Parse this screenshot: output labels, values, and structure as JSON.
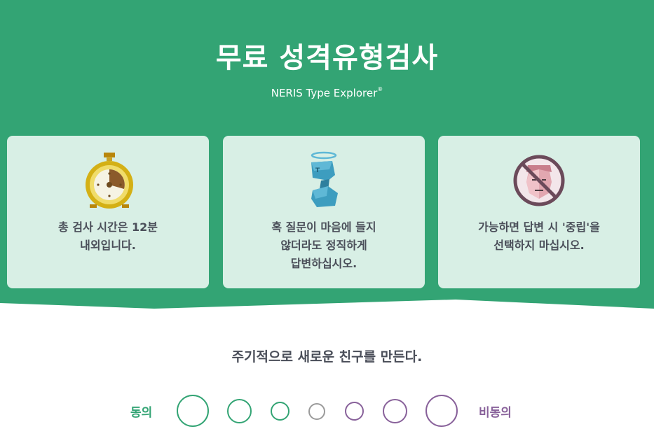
{
  "header": {
    "title": "무료 성격유형검사",
    "subtitle": "NERIS Type Explorer",
    "subtitle_mark": "®"
  },
  "cards": [
    {
      "icon": "stopwatch-icon",
      "text_lines": [
        "총 검사 시간은 12분",
        "내외입니다."
      ]
    },
    {
      "icon": "halo-character-icon",
      "text_lines": [
        "혹 질문이 마음에 들지",
        "않더라도 정직하게",
        "답변하십시오."
      ]
    },
    {
      "icon": "no-neutral-face-icon",
      "text_lines": [
        "가능하면 답변 시 '중립'을",
        "선택하지 마십시오."
      ]
    }
  ],
  "question": {
    "text": "주기적으로 새로운 친구를 만든다.",
    "agree_label": "동의",
    "disagree_label": "비동의",
    "options_count": 7
  },
  "colors": {
    "brand_green": "#33a474",
    "card_bg": "#d8efe5",
    "neutral_gray": "#9a9a9a",
    "disagree_purple": "#88619a",
    "text_dark": "#4a4e59"
  }
}
